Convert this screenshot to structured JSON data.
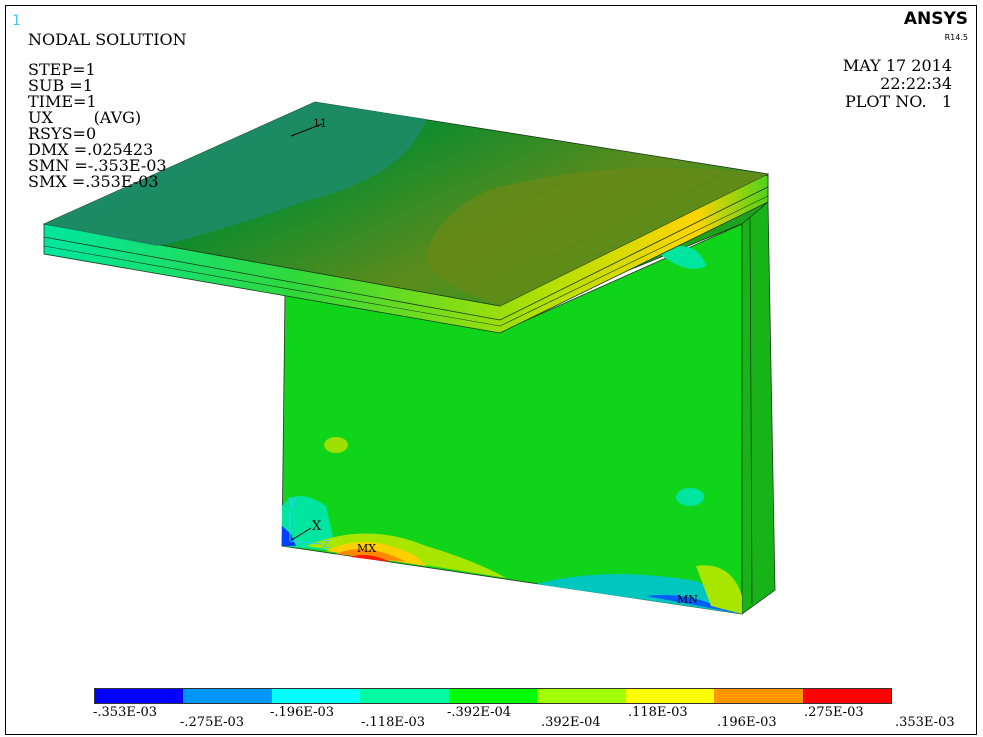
{
  "header": {
    "window_number": "1",
    "title": "NODAL SOLUTION",
    "brand": "ANSYS",
    "version": "R14.5",
    "date": "MAY 17 2014",
    "time": "22:22:34",
    "plot_no": "PLOT NO.   1"
  },
  "solution_info": [
    "STEP=1",
    "SUB =1",
    "TIME=1",
    "UX        (AVG)",
    "RSYS=0",
    "DMX =.025423",
    "SMN =-.353E-03",
    "SMX =.353E-03"
  ],
  "model": {
    "node_label": "11",
    "max_label": "MX",
    "min_label": "MN",
    "triad": {
      "x": "X",
      "y": "Y",
      "z": "Z"
    }
  },
  "legend": {
    "colors": [
      "#0000ff",
      "#0096ff",
      "#00ffff",
      "#00ffa0",
      "#00ff00",
      "#a0ff00",
      "#ffff00",
      "#ff9600",
      "#ff0000"
    ],
    "labels": [
      ".353E-03",
      "-.353E-03",
      "-.275E-03",
      "-.196E-03",
      "-.118E-03",
      "-.392E-04",
      ".392E-04",
      ".118E-03",
      ".196E-03",
      ".275E-03"
    ]
  }
}
